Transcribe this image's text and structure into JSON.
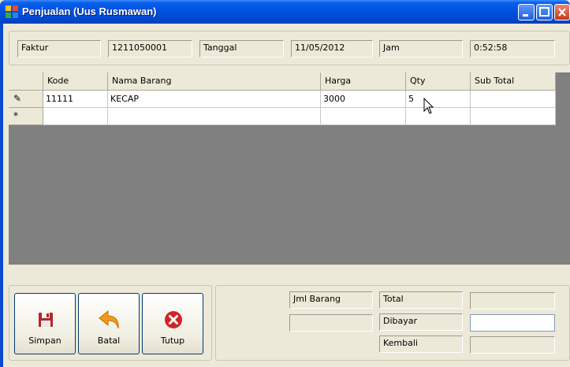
{
  "window": {
    "title": "Penjualan (Uus Rusmawan)"
  },
  "header": {
    "faktur_label": "Faktur",
    "faktur_value": "1211050001",
    "tanggal_label": "Tanggal",
    "tanggal_value": "11/05/2012",
    "jam_label": "Jam",
    "jam_value": "0:52:58"
  },
  "grid": {
    "columns": [
      "Kode",
      "Nama Barang",
      "Harga",
      "Qty",
      "Sub Total"
    ],
    "rows": [
      {
        "kode": "11111",
        "nama": "KECAP",
        "harga": "3000",
        "qty": "5",
        "subtotal": ""
      }
    ],
    "row_markers": [
      "✎",
      "*"
    ]
  },
  "buttons": {
    "simpan": "Simpan",
    "batal": "Batal",
    "tutup": "Tutup"
  },
  "summary": {
    "jml_barang_label": "Jml Barang",
    "jml_barang_value": "",
    "total_label": "Total",
    "total_value": "",
    "dibayar_label": "Dibayar",
    "dibayar_value": "",
    "kembali_label": "Kembali",
    "kembali_value": ""
  },
  "icons": {
    "app": "app-icon",
    "save": "floppy-disk-icon",
    "undo": "undo-arrow-icon",
    "close": "close-circle-icon"
  },
  "colors": {
    "titlebar": "#0054e3",
    "grid_background": "#808080",
    "close_red": "#d2232a"
  }
}
